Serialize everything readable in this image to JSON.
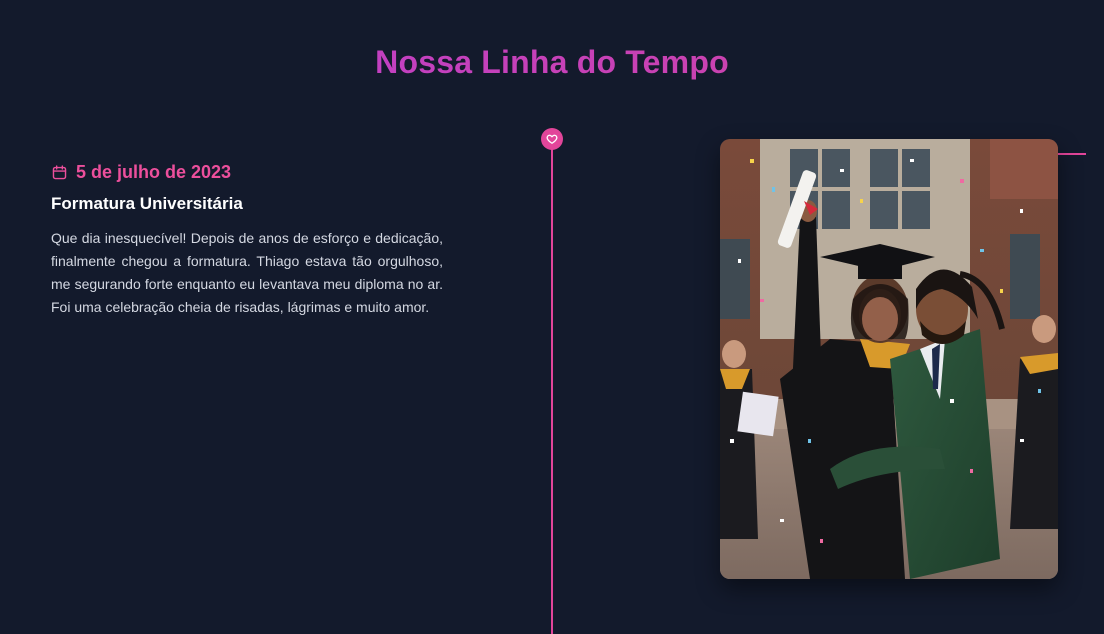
{
  "page": {
    "title": "Nossa Linha do Tempo"
  },
  "timeline": {
    "marker_icon": "heart-icon",
    "entries": [
      {
        "date_icon": "calendar-icon",
        "date": "5 de julho de 2023",
        "title": "Formatura Universitária",
        "description": "Que dia inesquecível! Depois de anos de esforço e dedicação, finalmente chegou a formatura. Thiago estava tão orgulhoso, me segurando forte enquanto eu levantava meu diploma no ar. Foi uma celebração cheia de risadas, lágrimas e muito amor.",
        "image_alt": "Foto da formatura com o casal se abraçando"
      }
    ]
  },
  "colors": {
    "background": "#131a2c",
    "accent_pink": "#e2459a",
    "title_gradient_start": "#bb3fd2",
    "title_gradient_end": "#d1439f",
    "text": "#d4d8e2",
    "heading": "#ffffff"
  }
}
